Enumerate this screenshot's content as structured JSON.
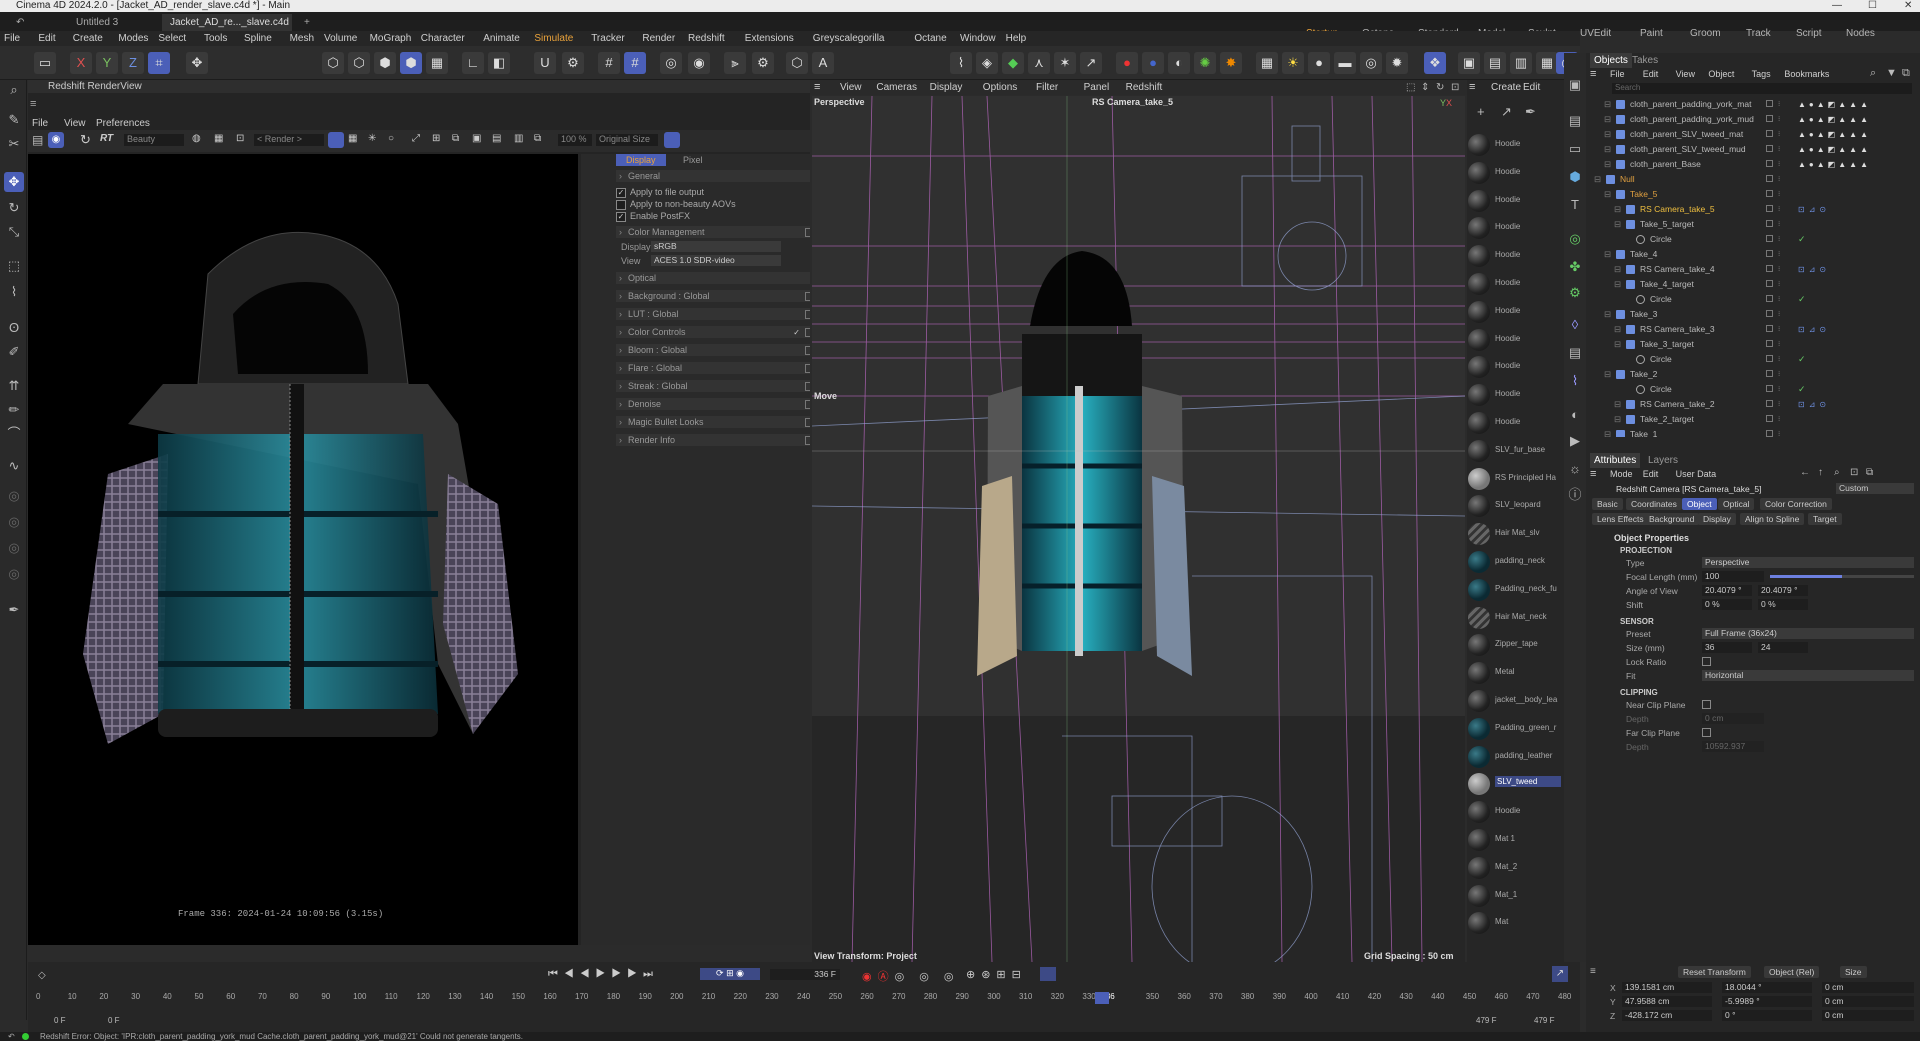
{
  "window": {
    "title": "Cinema 4D 2024.2.0 - [Jacket_AD_render_slave.c4d *] - Main"
  },
  "tabs": {
    "untitled": "Untitled 3",
    "active": "Jacket_AD_re..._slave.c4d *",
    "add": "+"
  },
  "layouts": [
    "Startup",
    "Octane",
    "Standard",
    "Model",
    "Sculpt",
    "UVEdit",
    "Paint",
    "Groom",
    "Track",
    "Script",
    "Nodes"
  ],
  "menu": [
    "File",
    "Edit",
    "Create",
    "Modes",
    "Select",
    "Tools",
    "Spline",
    "Mesh",
    "Volume",
    "MoGraph",
    "Character",
    "Animate",
    "Simulate",
    "Tracker",
    "Render",
    "Redshift",
    "Extensions",
    "Greyscalegorilla",
    "Octane",
    "Window",
    "Help"
  ],
  "renderview": {
    "title": "Redshift RenderView",
    "menu": [
      "File",
      "View",
      "Preferences"
    ],
    "rt": "RT",
    "aov": "Beauty",
    "render_dd": "< Render >",
    "zoom": "100 %",
    "size": "Original Size",
    "tabs": {
      "display": "Display",
      "pixel": "Pixel"
    },
    "general": "General",
    "checks": [
      "Apply to file output",
      "Apply to non-beauty AOVs",
      "Enable PostFX"
    ],
    "color_mgmt": "Color Management",
    "display_label": "Display",
    "display_val": "sRGB",
    "view_label": "View",
    "view_val": "ACES 1.0 SDR-video",
    "sections": [
      "Optical",
      "Background : Global",
      "LUT : Global",
      "Color Controls",
      "Bloom : Global",
      "Flare : Global",
      "Streak : Global",
      "Denoise",
      "Magic Bullet Looks",
      "Render Info"
    ],
    "frame_info": "Frame  336:  2024-01-24  10:09:56  (3.15s)"
  },
  "viewport": {
    "menu": [
      "View",
      "Cameras",
      "Display",
      "Options",
      "Filter",
      "Panel",
      "Redshift"
    ],
    "name": "Perspective",
    "camera": "RS Camera_take_5",
    "hud": "Move",
    "view_transform": "View Transform: Project",
    "grid": "Grid Spacing : 50 cm"
  },
  "materials": {
    "menu": [
      "Create",
      "Edit"
    ],
    "items": [
      "Hoodie",
      "Hoodie",
      "Hoodie",
      "Hoodie",
      "Hoodie",
      "Hoodie",
      "Hoodie",
      "Hoodie",
      "Hoodie",
      "Hoodie",
      "Hoodie",
      "SLV_fur_base",
      "RS Principled Ha",
      "SLV_leopard",
      "Hair Mat_slv",
      "padding_neck",
      "Padding_neck_fu",
      "Hair Mat_neck",
      "Zipper_tape",
      "Metal",
      "jacket__body_lea",
      "Padding_green_r",
      "padding_leather",
      "SLV_tweed",
      "Hoodie",
      "Mat 1",
      "Mat_2",
      "Mat_1",
      "Mat"
    ]
  },
  "objects": {
    "tabs": [
      "Objects",
      "Takes"
    ],
    "menu": [
      "File",
      "Edit",
      "View",
      "Object",
      "Tags",
      "Bookmarks"
    ],
    "search": "Search",
    "rows": [
      {
        "name": "cloth_parent_padding_york_mat",
        "indent": 1
      },
      {
        "name": "cloth_parent_padding_york_mud",
        "indent": 1
      },
      {
        "name": "cloth_parent_SLV_tweed_mat",
        "indent": 1
      },
      {
        "name": "cloth_parent_SLV_tweed_mud",
        "indent": 1
      },
      {
        "name": "cloth_parent_Base",
        "indent": 1
      },
      {
        "name": "Null",
        "indent": 0,
        "color": "#e0a040"
      },
      {
        "name": "Take_5",
        "indent": 1,
        "color": "#e0a040"
      },
      {
        "name": "RS Camera_take_5",
        "indent": 2,
        "color": "#f0c040"
      },
      {
        "name": "Take_5_target",
        "indent": 2
      },
      {
        "name": "Circle",
        "indent": 3
      },
      {
        "name": "Take_4",
        "indent": 1
      },
      {
        "name": "RS Camera_take_4",
        "indent": 2
      },
      {
        "name": "Take_4_target",
        "indent": 2
      },
      {
        "name": "Circle",
        "indent": 3
      },
      {
        "name": "Take_3",
        "indent": 1
      },
      {
        "name": "RS Camera_take_3",
        "indent": 2
      },
      {
        "name": "Take_3_target",
        "indent": 2
      },
      {
        "name": "Circle",
        "indent": 3
      },
      {
        "name": "Take_2",
        "indent": 1
      },
      {
        "name": "Circle",
        "indent": 3
      },
      {
        "name": "RS Camera_take_2",
        "indent": 2
      },
      {
        "name": "Take_2_target",
        "indent": 2
      },
      {
        "name": "Take_1",
        "indent": 1
      }
    ]
  },
  "attributes": {
    "tabs": [
      "Attributes",
      "Layers"
    ],
    "menu": [
      "Mode",
      "Edit",
      "User Data"
    ],
    "object": "Redshift Camera [RS Camera_take_5]",
    "preset": "Custom",
    "subtabs": [
      "Basic",
      "Coordinates",
      "Object",
      "Optical",
      "Color Correction"
    ],
    "subtabs2": [
      "Lens Effects",
      "Background",
      "Display",
      "Align to Spline",
      "Target"
    ],
    "header": "Object Properties",
    "projection": "PROJECTION",
    "type_l": "Type",
    "type_v": "Perspective",
    "focal_l": "Focal Length (mm)",
    "focal_v": "100",
    "aov_l": "Angle of View",
    "aov_v1": "20.4079 °",
    "aov_v2": "20.4079 °",
    "shift_l": "Shift",
    "shift_v1": "0 %",
    "shift_v2": "0 %",
    "sensor": "SENSOR",
    "preset_l": "Preset",
    "preset_v": "Full Frame (36x24)",
    "size_l": "Size (mm)",
    "size_v1": "36",
    "size_v2": "24",
    "lock_l": "Lock Ratio",
    "fit_l": "Fit",
    "fit_v": "Horizontal",
    "clipping": "CLIPPING",
    "near_l": "Near Clip Plane",
    "depth_l": "Depth",
    "depth_v1": "0 cm",
    "far_l": "Far Clip Plane",
    "depth_v2": "10592.937"
  },
  "coords": {
    "reset": "Reset Transform",
    "mode": "Object (Rel)",
    "size": "Size",
    "x": "X",
    "y": "Y",
    "z": "Z",
    "px": "139.1581 cm",
    "py": "47.9588 cm",
    "pz": "-428.172 cm",
    "rx": "18.0044 °",
    "ry": "-5.9989 °",
    "rz": "0 °",
    "sx": "0 cm",
    "sy": "0 cm",
    "sz": "0 cm"
  },
  "timeline": {
    "frame": "336 F",
    "start": "0 F",
    "start2": "0 F",
    "end": "479 F",
    "end2": "479 F",
    "ticks": [
      "0",
      "10",
      "20",
      "30",
      "40",
      "50",
      "60",
      "70",
      "80",
      "90",
      "100",
      "110",
      "120",
      "130",
      "140",
      "150",
      "160",
      "170",
      "180",
      "190",
      "200",
      "210",
      "220",
      "230",
      "240",
      "250",
      "260",
      "270",
      "280",
      "290",
      "300",
      "310",
      "320",
      "330",
      "336",
      "350",
      "360",
      "370",
      "380",
      "390",
      "400",
      "410",
      "420",
      "430",
      "440",
      "450",
      "460",
      "470",
      "480"
    ]
  },
  "status": "Redshift Error: Object: 'IPR:cloth_parent_padding_york_mud Cache.cloth_parent_padding_york_mud@21' Could not generate tangents."
}
